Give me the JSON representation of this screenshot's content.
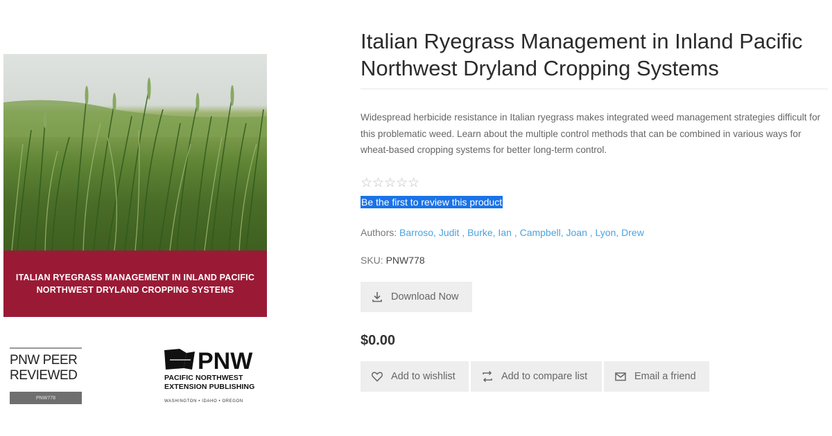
{
  "cover": {
    "band_text": "ITALIAN RYEGRASS MANAGEMENT IN INLAND PACIFIC\nNORTHWEST DRYLAND CROPPING SYSTEMS",
    "band_color": "#9a1a36"
  },
  "logos": {
    "peer_line1": "PNW PEER",
    "peer_line2": "REVIEWED",
    "peer_code": "PNW778",
    "pnw_mark": "PNW",
    "pnw_name": "PACIFIC NORTHWEST\nEXTENSION PUBLISHING",
    "pnw_states": "WASHINGTON • IDAHO • OREGON"
  },
  "product": {
    "title": "Italian Ryegrass Management in Inland Pacific Northwest Dryland Cropping Systems",
    "description": "Widespread herbicide resistance in Italian ryegrass makes integrated weed management strategies difficult for this problematic weed. Learn about the multiple control methods that can be combined in various ways for wheat-based cropping systems for better long-term control.",
    "rating_stars": "☆☆☆☆☆",
    "rating_value": 0,
    "review_link": "Be the first to review this product",
    "authors_label": "Authors:",
    "authors": [
      "Barroso, Judit",
      "Burke, Ian",
      "Campbell, Joan",
      "Lyon, Drew"
    ],
    "author_separator": ",",
    "sku_label": "SKU:",
    "sku_value": "PNW778",
    "download_label": "Download Now",
    "price": "$0.00",
    "wishlist_label": "Add to wishlist",
    "compare_label": "Add to compare list",
    "email_label": "Email a friend"
  },
  "icons": {
    "download": "download-icon",
    "wishlist": "heart-icon",
    "compare": "compare-icon",
    "email": "envelope-icon"
  },
  "colors": {
    "link": "#4aa3df",
    "selection": "#1a73e8",
    "button_bg": "#eeeeee"
  }
}
